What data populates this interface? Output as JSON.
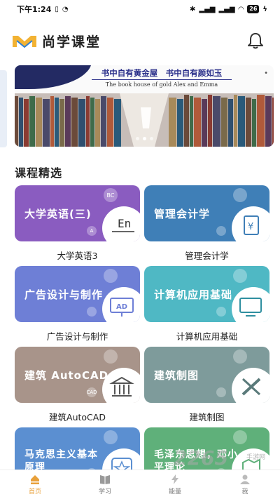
{
  "status_bar": {
    "time": "下午1:24",
    "battery": "26"
  },
  "header": {
    "title": "尚学课堂"
  },
  "banner": {
    "text_cn": "书中自有黄金屋　书中自有颜如玉",
    "text_en": "The book house of gold Alex and Emma"
  },
  "section": {
    "title": "课程精选"
  },
  "courses": [
    {
      "card_text": "大学英语(三)",
      "caption": "大学英语3",
      "color": "#8a5cc0",
      "icon": "en-icon",
      "badge_top": "BC",
      "badge_bottom": "A"
    },
    {
      "card_text": "管理会计学",
      "caption": "管理会计学",
      "color": "#3f7fb7",
      "icon": "clipboard-yen-icon"
    },
    {
      "card_text": "广告设计与制作",
      "caption": "广告设计与制作",
      "color": "#6e7fd6",
      "icon": "ad-board-icon"
    },
    {
      "card_text": "计算机应用基础",
      "caption": "计算机应用基础",
      "color": "#4fb8c4",
      "icon": "computer-icon"
    },
    {
      "card_text": "建筑 AutoCAD",
      "caption": "建筑AutoCAD",
      "color": "#a8948a",
      "icon": "building-columns-icon",
      "badge_bottom": "CAD"
    },
    {
      "card_text": "建筑制图",
      "caption": "建筑制图",
      "color": "#7e9b9b",
      "icon": "ruler-pencil-icon"
    },
    {
      "card_text": "马克思主义基本原理",
      "card_text_l1": "马克思主义基本",
      "card_text_l2": "原理",
      "color": "#5b8fd1",
      "icon": "star-badge-icon"
    },
    {
      "card_text": "毛泽东思想，邓小平理论",
      "card_text_l1": "毛泽东思想，邓小",
      "card_text_l2": "平理论",
      "color": "#5fb07a",
      "icon": "map-icon"
    }
  ],
  "nav": [
    {
      "label": "首页",
      "icon": "home-icon",
      "active": true
    },
    {
      "label": "学习",
      "icon": "book-icon",
      "active": false
    },
    {
      "label": "能量",
      "icon": "energy-icon",
      "active": false
    },
    {
      "label": "我",
      "icon": "profile-icon",
      "active": false
    }
  ],
  "watermark": {
    "text": "2265",
    "sub": "手游网"
  },
  "colors": {
    "accent": "#e8a03a"
  }
}
